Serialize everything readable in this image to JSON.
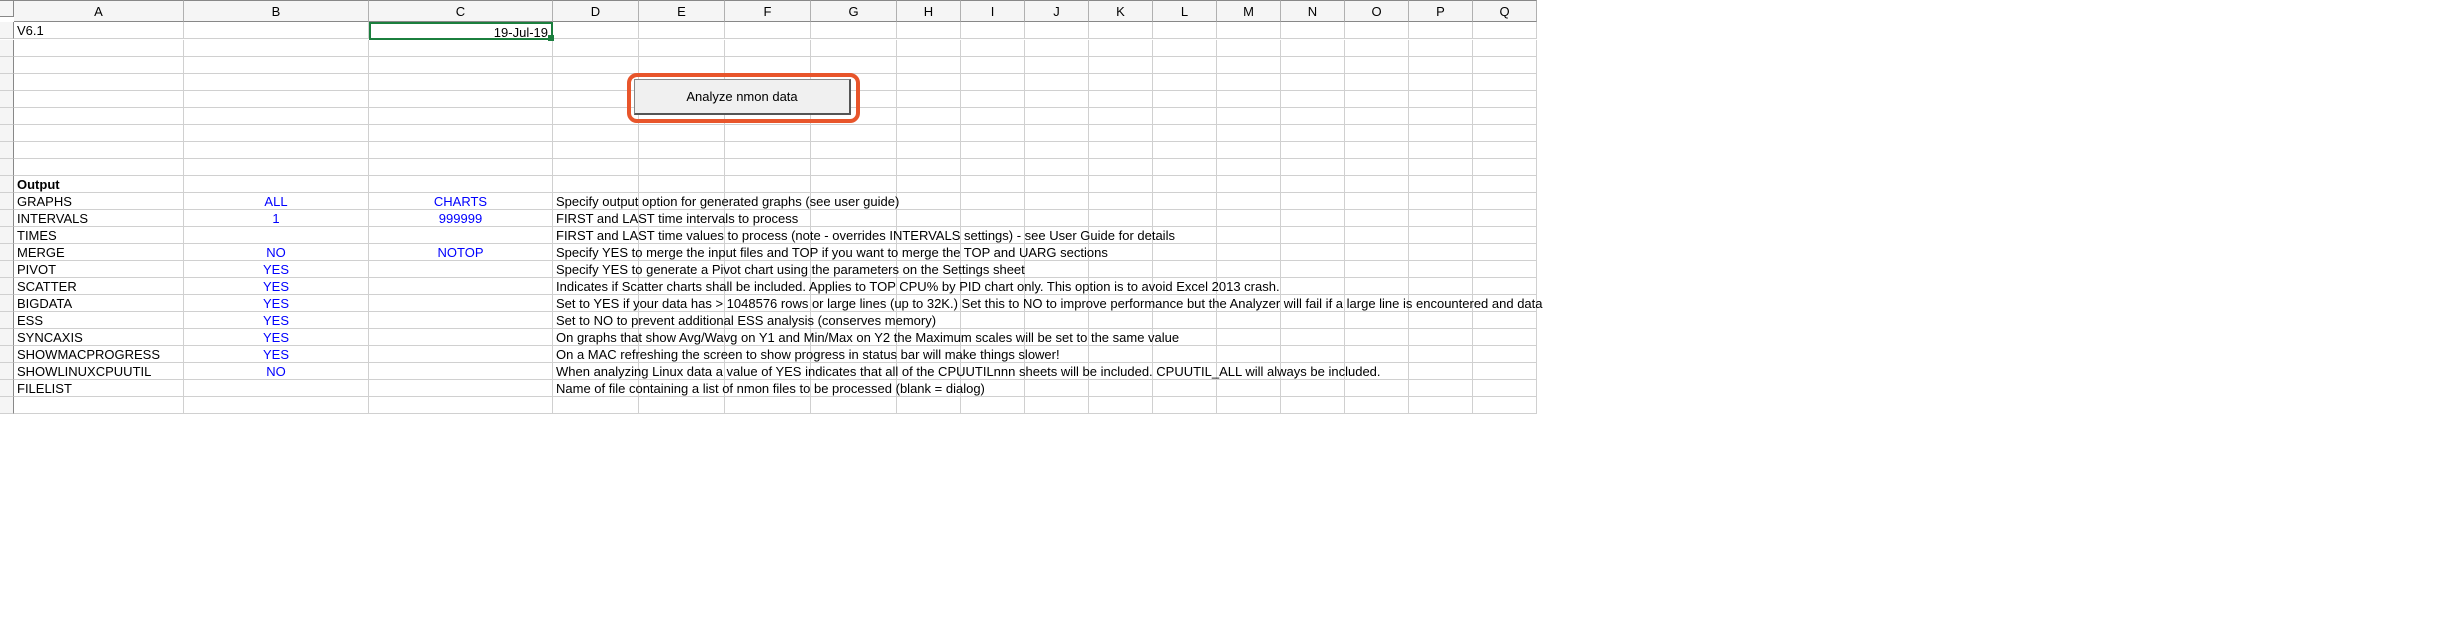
{
  "columns": [
    "",
    "A",
    "B",
    "C",
    "D",
    "E",
    "F",
    "G",
    "H",
    "I",
    "J",
    "K",
    "L",
    "M",
    "N",
    "O",
    "P",
    "Q"
  ],
  "version": "V6.1",
  "date": "19-Jul-19",
  "button": {
    "label": "Analyze nmon data"
  },
  "output_header": "Output",
  "rows": [
    {
      "a": "GRAPHS",
      "b": "ALL",
      "c": "CHARTS",
      "d": "Specify output option for generated graphs (see user guide)"
    },
    {
      "a": "INTERVALS",
      "b": "1",
      "c": "999999",
      "d": "FIRST and LAST time intervals to process"
    },
    {
      "a": "TIMES",
      "b": "",
      "c": "",
      "d": "FIRST and LAST time values to process (note - overrides INTERVALS settings) - see User Guide for details"
    },
    {
      "a": "MERGE",
      "b": "NO",
      "c": "NOTOP",
      "d": "Specify YES to merge the input files and TOP if you want to merge the TOP and UARG sections"
    },
    {
      "a": "PIVOT",
      "b": "YES",
      "c": "",
      "d": "Specify YES to generate a Pivot chart using the parameters on the Settings sheet"
    },
    {
      "a": "SCATTER",
      "b": "YES",
      "c": "",
      "d": "Indicates if Scatter charts shall be included.  Applies to TOP CPU% by PID chart only.  This option is to avoid Excel 2013 crash."
    },
    {
      "a": "BIGDATA",
      "b": "YES",
      "c": "",
      "d": "Set to YES if your data has > 1048576 rows or large lines (up to 32K.)  Set this to NO to improve performance but the Analyzer will fail if a large line is encountered and data"
    },
    {
      "a": "ESS",
      "b": "YES",
      "c": "",
      "d": "Set to NO to prevent additional ESS analysis (conserves memory)"
    },
    {
      "a": "SYNCAXIS",
      "b": "YES",
      "c": "",
      "d": "On graphs that show Avg/Wavg on Y1 and Min/Max on Y2 the Maximum scales will be set to the same value"
    },
    {
      "a": "SHOWMACPROGRESS",
      "b": "YES",
      "c": "",
      "d": "On a MAC refreshing the screen to show progress in status bar will make things slower!"
    },
    {
      "a": "SHOWLINUXCPUUTIL",
      "b": "NO",
      "c": "",
      "d": "When analyzing Linux data a value of YES indicates that all of the CPUUTILnnn sheets will be included.  CPUUTIL_ALL will always be included."
    },
    {
      "a": "FILELIST",
      "b": "",
      "c": "",
      "d": "Name of file containing a list of nmon files to be processed (blank = dialog)"
    }
  ]
}
